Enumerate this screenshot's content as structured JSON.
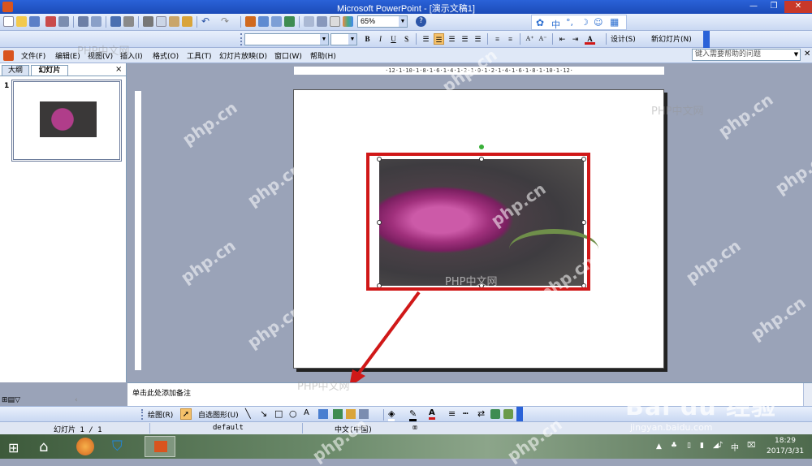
{
  "window": {
    "title": "Microsoft PowerPoint - [演示文稿1]"
  },
  "toolbar": {
    "zoom": "65%"
  },
  "ime": {
    "zh": "中"
  },
  "format_toolbar": {
    "font_name": "",
    "font_size": "",
    "bold": "B",
    "italic": "I",
    "underline": "U",
    "shadow": "S",
    "design_label": "设计(S)",
    "new_slide_label": "新幻灯片(N)"
  },
  "menu": {
    "items": [
      "文件(F)",
      "编辑(E)",
      "视图(V)",
      "插入(I)",
      "格式(O)",
      "工具(T)",
      "幻灯片放映(D)",
      "窗口(W)",
      "帮助(H)"
    ],
    "help_placeholder": "键入需要帮助的问题"
  },
  "panel": {
    "tab_outline": "大纲",
    "tab_slides": "幻灯片",
    "close": "×",
    "slide_number": "1"
  },
  "ruler": {
    "labels": "·12·1·10·1·8·1·6·1·4·1·2·1·0·1·2·1·4·1·6·1·8·1·10·1·12·"
  },
  "notes": {
    "placeholder": "单击此处添加备注"
  },
  "drawing_toolbar": {
    "draw_label": "绘图(R)",
    "autoshape_label": "自选图形(U)"
  },
  "statusbar": {
    "slide_info": "幻灯片 1 / 1",
    "design": "default",
    "language": "中文(中国)"
  },
  "taskbar": {
    "ime": "中",
    "time": "18:29",
    "date": "2017/3/31"
  },
  "watermarks": {
    "php_cn": "php.cn",
    "php_zh": "PHP中文网",
    "baidu": "Bai du 经验",
    "baidu_url": "jingyan.baidu.com"
  },
  "colors": {
    "title_bar": "#2a62d8",
    "highlight_box": "#d01818",
    "flower": "#b03d8a"
  }
}
